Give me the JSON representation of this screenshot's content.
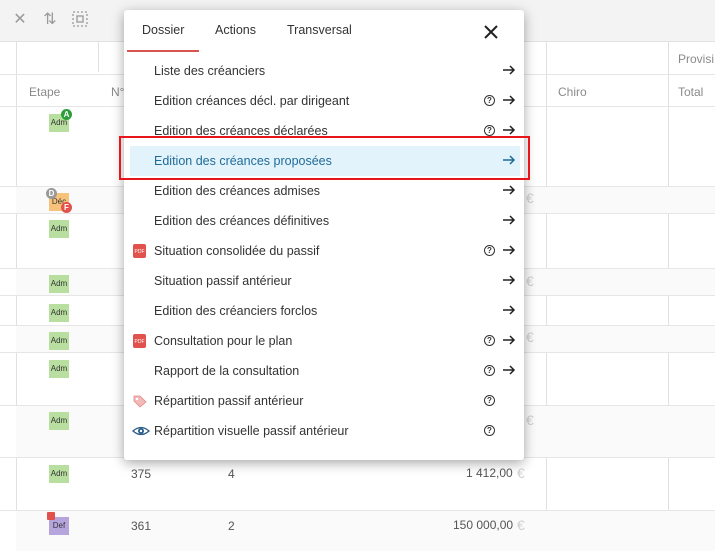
{
  "toolbar": {
    "icons": [
      "close-icon",
      "sort-icon",
      "select-area-icon"
    ]
  },
  "grid": {
    "headers": {
      "etape": "Etape",
      "num": "N°",
      "chiro": "Chiro",
      "total": "Total",
      "provisi": "Provisi"
    },
    "rows": [
      {
        "tag": "Adm"
      },
      {
        "tag": "Déc"
      },
      {
        "tag": "Adm"
      },
      {
        "tag": "Adm"
      },
      {
        "tag": "Adm"
      },
      {
        "tag": "Adm"
      },
      {
        "tag": "Adm"
      },
      {
        "tag": "Adm"
      },
      {
        "tag": "Adm",
        "num": "375",
        "col2": "4",
        "amount": "1 412,00",
        "currency": "€"
      },
      {
        "tag": "Def",
        "num": "361",
        "col2": "2",
        "amount": "150 000,00",
        "currency": "€"
      }
    ],
    "badges": {
      "a": "A",
      "d": "D",
      "f": "F"
    },
    "currency": "€"
  },
  "menu": {
    "tabs": [
      {
        "label": "Dossier"
      },
      {
        "label": "Actions"
      },
      {
        "label": "Transversal"
      }
    ],
    "items": [
      {
        "label": "Liste des créanciers",
        "help": false,
        "arrow": true,
        "icon": ""
      },
      {
        "label": "Edition créances décl. par dirigeant",
        "help": true,
        "arrow": true,
        "icon": ""
      },
      {
        "label": "Edition des créances déclarées",
        "help": true,
        "arrow": true,
        "icon": ""
      },
      {
        "label": "Edition des créances proposées",
        "help": false,
        "arrow": true,
        "icon": "",
        "active": true
      },
      {
        "label": "Edition des créances admises",
        "help": false,
        "arrow": true,
        "icon": ""
      },
      {
        "label": "Edition des créances définitives",
        "help": false,
        "arrow": true,
        "icon": ""
      },
      {
        "label": "Situation consolidée du passif",
        "help": true,
        "arrow": true,
        "icon": "pdf-icon"
      },
      {
        "label": "Situation passif antérieur",
        "help": false,
        "arrow": true,
        "icon": ""
      },
      {
        "label": "Edition des créanciers forclos",
        "help": false,
        "arrow": true,
        "icon": ""
      },
      {
        "label": "Consultation pour le plan",
        "help": true,
        "arrow": true,
        "icon": "pdf-icon"
      },
      {
        "label": "Rapport de la consultation",
        "help": true,
        "arrow": true,
        "icon": ""
      },
      {
        "label": "Répartition passif antérieur",
        "help": true,
        "arrow": false,
        "icon": "tag-icon"
      },
      {
        "label": "Répartition visuelle passif antérieur",
        "help": true,
        "arrow": false,
        "icon": "eye-icon"
      }
    ],
    "help_glyph": "?",
    "pdf_text": "PDF"
  },
  "colors": {
    "highlight": "#e8161b",
    "active_bg": "#e3f3fb",
    "active_text": "#1f6b99",
    "tab_underline": "#d9534f"
  }
}
